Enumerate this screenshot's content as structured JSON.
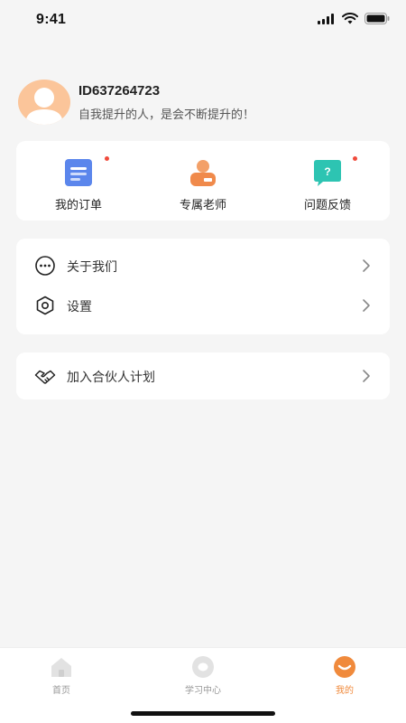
{
  "status_bar": {
    "time": "9:41"
  },
  "profile": {
    "id": "ID637264723",
    "bio": "自我提升的人，是会不断提升的！"
  },
  "quick_actions": [
    {
      "label": "我的订单",
      "icon": "order-document-icon",
      "color": "#4a7bea",
      "badge": true
    },
    {
      "label": "专属老师",
      "icon": "teacher-icon",
      "color": "#f08a4b",
      "badge": false
    },
    {
      "label": "问题反馈",
      "icon": "feedback-question-icon",
      "color": "#29c3b0",
      "badge": true
    }
  ],
  "menu": {
    "items": [
      {
        "label": "关于我们",
        "icon": "chat-dots-icon"
      },
      {
        "label": "设置",
        "icon": "settings-hexagon-icon"
      }
    ]
  },
  "partner": {
    "label": "加入合伙人计划",
    "icon": "handshake-icon"
  },
  "tabs": [
    {
      "label": "首页",
      "icon": "home-icon",
      "active": false
    },
    {
      "label": "学习中心",
      "icon": "learning-center-icon",
      "active": false
    },
    {
      "label": "我的",
      "icon": "profile-face-icon",
      "active": true
    }
  ],
  "colors": {
    "accent": "#f08a3c",
    "background": "#f5f5f5",
    "badge": "#f04b3c"
  }
}
